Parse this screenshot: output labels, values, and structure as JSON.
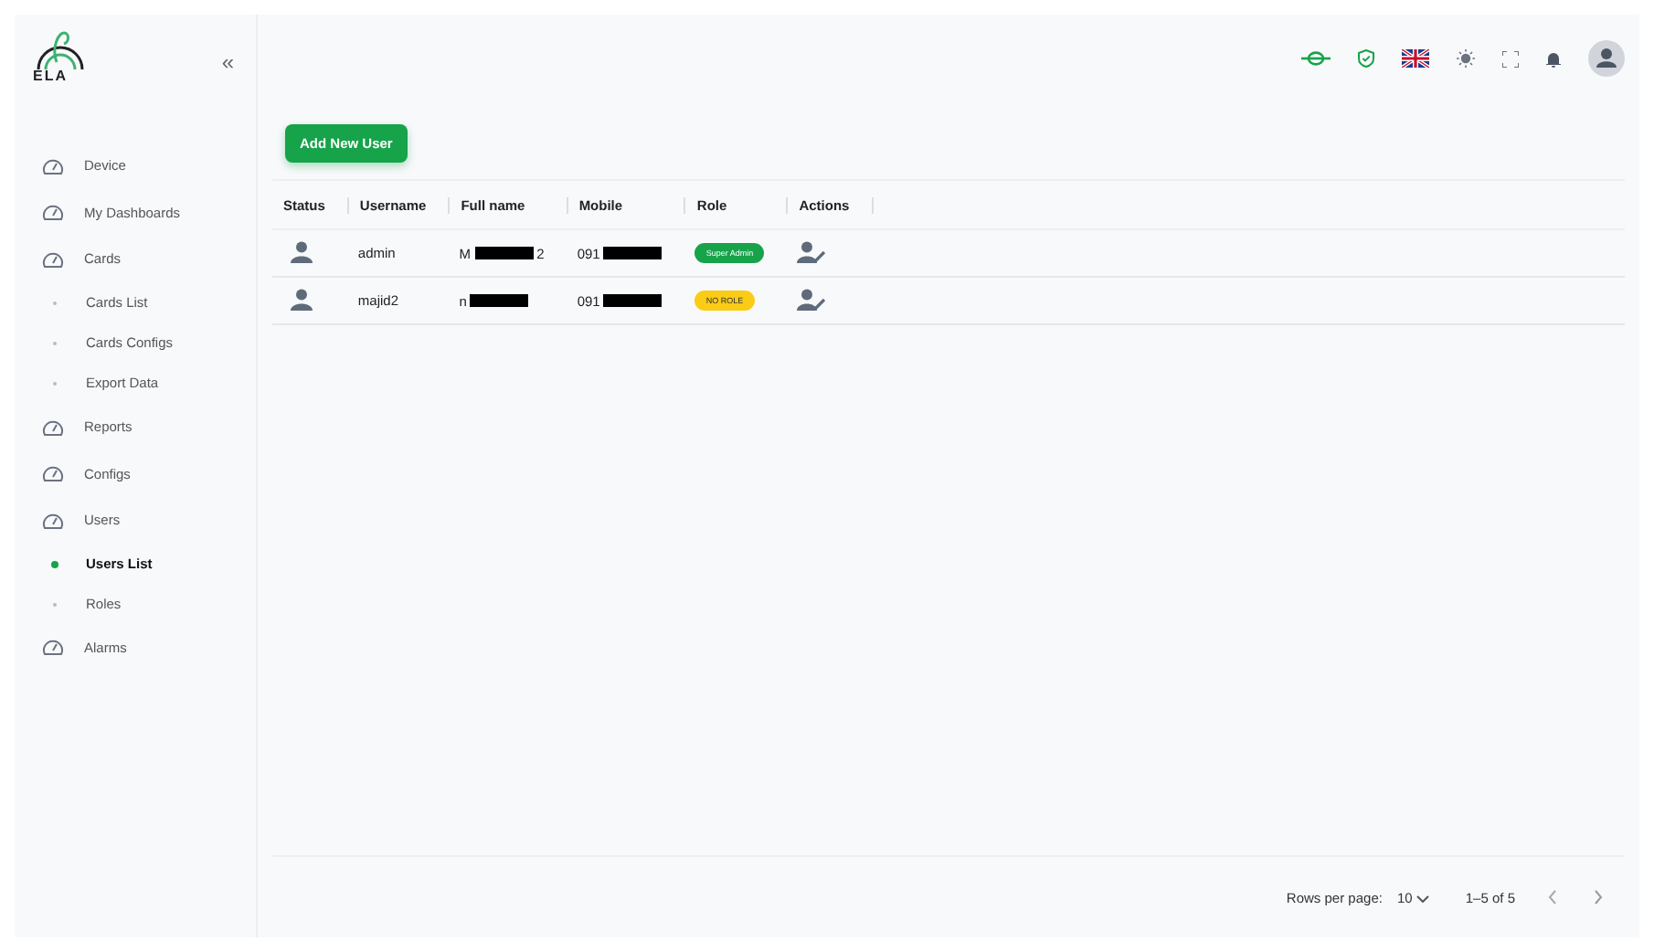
{
  "logo": {
    "text": "ELA"
  },
  "sidebar": {
    "collapse_icon": "«",
    "items": [
      {
        "label": "Device",
        "selected": false
      },
      {
        "label": "My Dashboards",
        "selected": false
      },
      {
        "label": "Cards",
        "selected": false,
        "children": [
          {
            "label": "Cards List",
            "selected": false
          },
          {
            "label": "Cards Configs",
            "selected": false
          },
          {
            "label": "Export Data",
            "selected": false
          }
        ]
      },
      {
        "label": "Reports",
        "selected": false
      },
      {
        "label": "Configs",
        "selected": false
      },
      {
        "label": "Users",
        "selected": false,
        "children": [
          {
            "label": "Users List",
            "selected": true
          },
          {
            "label": "Roles",
            "selected": false
          }
        ]
      },
      {
        "label": "Alarms",
        "selected": false
      }
    ]
  },
  "add_button": "Add New User",
  "table": {
    "columns": [
      "Status",
      "Username",
      "Full name",
      "Mobile",
      "Role",
      "Actions"
    ],
    "rows": [
      {
        "username": "admin",
        "full_name": [
          "M",
          "2"
        ],
        "mobile": [
          "091"
        ],
        "role": {
          "label": "Super Admin",
          "color": "#16a34a"
        }
      },
      {
        "username": "majid2",
        "full_name": [
          "n"
        ],
        "mobile": [
          "091"
        ],
        "role": {
          "label": "NO ROLE",
          "color": "#facc15"
        }
      }
    ]
  },
  "pagination": {
    "rows_per_page_label": "Rows per page:",
    "rows_per_page": "10",
    "range": "1–5 of 5"
  }
}
